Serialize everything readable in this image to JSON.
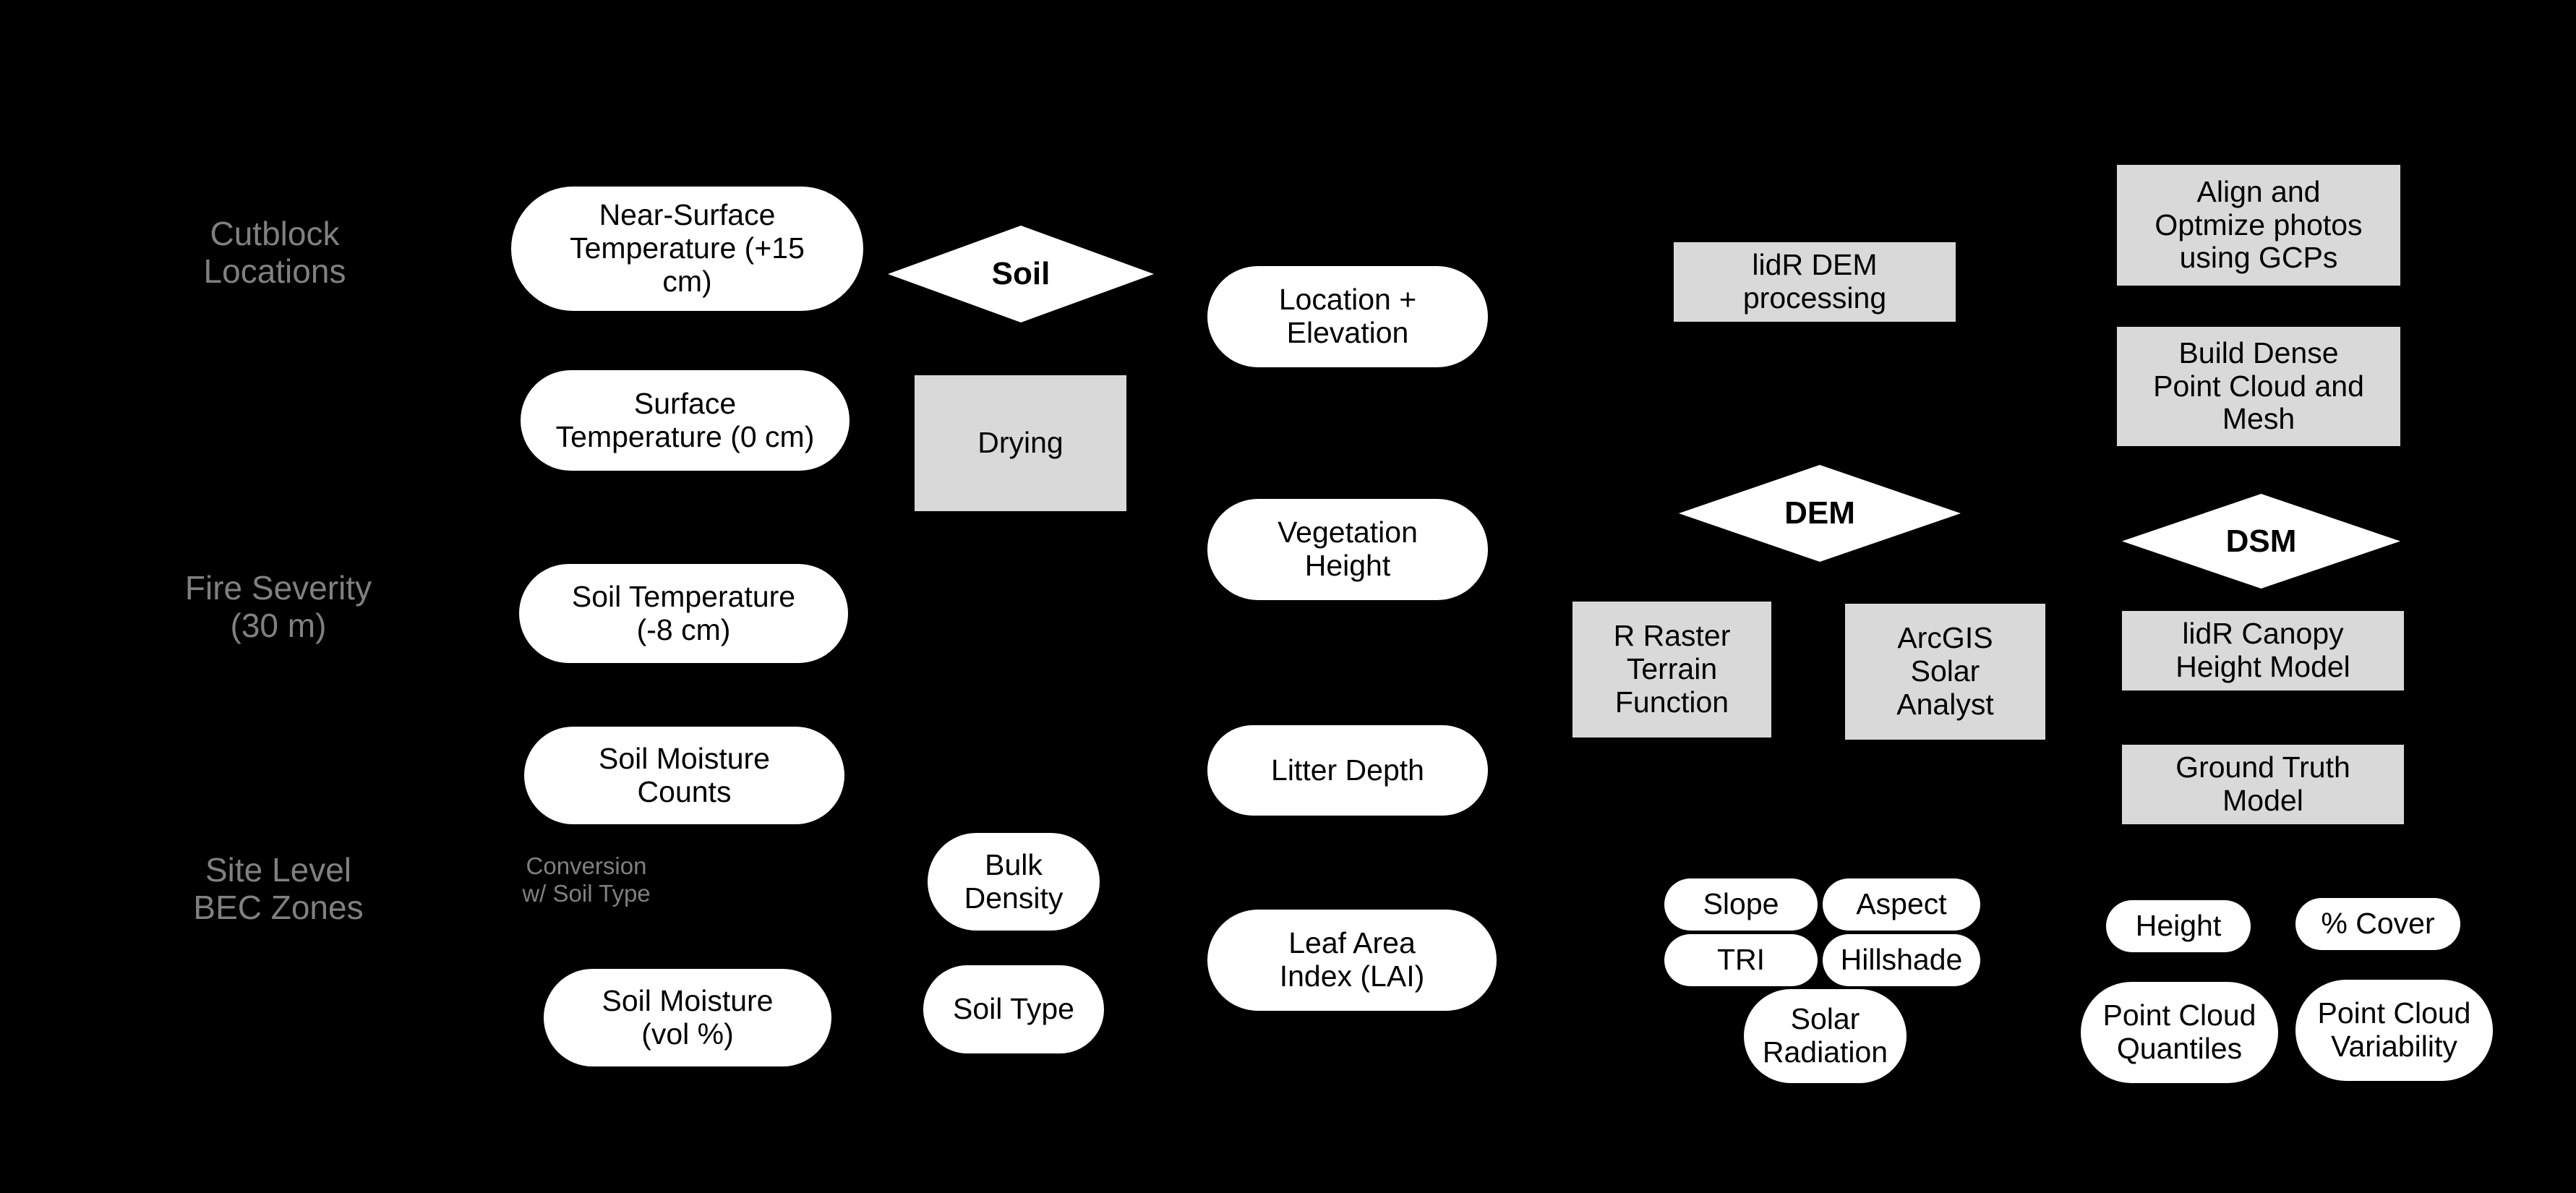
{
  "diagram": {
    "background_color": "#000000",
    "process_box_color": "#d9d9d9",
    "data_node_color": "#ffffff",
    "label_color": "#808080",
    "group_labels": [
      {
        "text": "Cutblock\nLocations"
      },
      {
        "text": "Fire Severity\n(30 m)"
      },
      {
        "text": "Site Level\nBEC Zones"
      }
    ],
    "annotations": [
      {
        "text": "Conversion\nw/ Soil Type"
      }
    ],
    "column_1_nodes": [
      {
        "text": "Near-Surface\nTemperature (+15\ncm)",
        "shape": "pill"
      },
      {
        "text": "Surface\nTemperature (0 cm)",
        "shape": "pill"
      },
      {
        "text": "Soil Temperature\n(-8 cm)",
        "shape": "pill"
      },
      {
        "text": "Soil Moisture\nCounts",
        "shape": "pill"
      },
      {
        "text": "Soil Moisture\n(vol %)",
        "shape": "pill"
      }
    ],
    "column_2_nodes": [
      {
        "text": "Soil",
        "shape": "diamond"
      },
      {
        "text": "Drying",
        "shape": "rect"
      },
      {
        "text": "Bulk\nDensity",
        "shape": "pill"
      },
      {
        "text": "Soil Type",
        "shape": "pill"
      }
    ],
    "column_3_nodes": [
      {
        "text": "Location +\nElevation",
        "shape": "pill"
      },
      {
        "text": "Vegetation\nHeight",
        "shape": "pill"
      },
      {
        "text": "Litter Depth",
        "shape": "pill"
      },
      {
        "text": "Leaf Area\nIndex (LAI)",
        "shape": "pill"
      }
    ],
    "column_4_nodes": [
      {
        "text": "lidR DEM\nprocessing",
        "shape": "rect"
      },
      {
        "text": "DEM",
        "shape": "diamond"
      },
      {
        "text": "R Raster\nTerrain\nFunction",
        "shape": "rect"
      },
      {
        "text": "ArcGIS\nSolar\nAnalyst",
        "shape": "rect"
      },
      {
        "text": "Slope",
        "shape": "pill"
      },
      {
        "text": "Aspect",
        "shape": "pill"
      },
      {
        "text": "TRI",
        "shape": "pill"
      },
      {
        "text": "Hillshade",
        "shape": "pill"
      },
      {
        "text": "Solar\nRadiation",
        "shape": "pill"
      }
    ],
    "column_5_nodes": [
      {
        "text": "Align and\nOptmize photos\nusing GCPs",
        "shape": "rect"
      },
      {
        "text": "Build Dense\nPoint Cloud and\nMesh",
        "shape": "rect"
      },
      {
        "text": "DSM",
        "shape": "diamond"
      },
      {
        "text": "lidR Canopy\nHeight Model",
        "shape": "rect"
      },
      {
        "text": "Ground Truth\nModel",
        "shape": "rect"
      },
      {
        "text": "Height",
        "shape": "pill"
      },
      {
        "text": "% Cover",
        "shape": "pill"
      },
      {
        "text": "Point Cloud\nQuantiles",
        "shape": "pill"
      },
      {
        "text": "Point Cloud\nVariability",
        "shape": "pill"
      }
    ]
  }
}
